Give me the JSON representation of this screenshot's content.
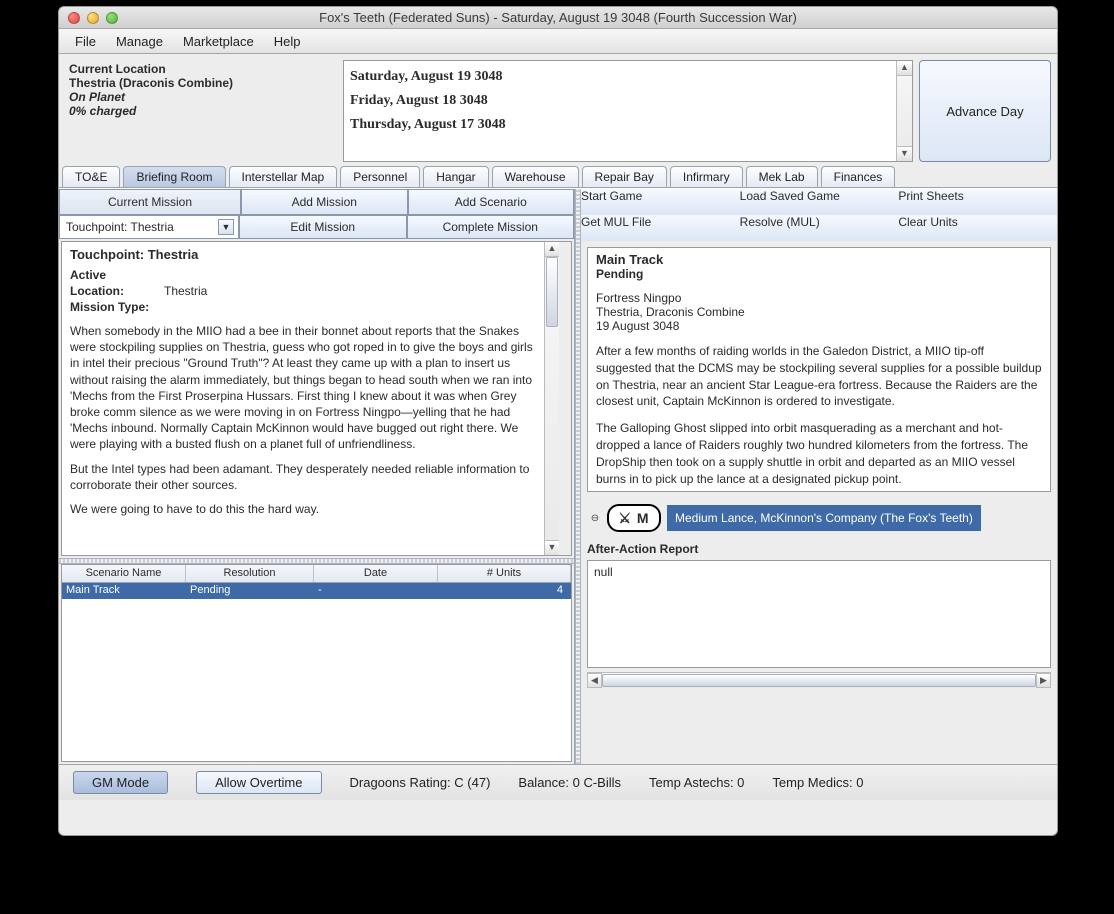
{
  "window": {
    "title": "Fox's Teeth (Federated Suns) - Saturday, August 19 3048 (Fourth Succession War)"
  },
  "menu": {
    "items": [
      "File",
      "Manage",
      "Marketplace",
      "Help"
    ]
  },
  "location": {
    "heading": "Current Location",
    "planet": "Thestria (Draconis Combine)",
    "status": "On Planet",
    "charge": "0% charged"
  },
  "log": {
    "entries": [
      "Saturday, August 19 3048",
      "Friday, August 18 3048",
      "Thursday, August 17 3048"
    ]
  },
  "advance_button": "Advance Day",
  "tabs": {
    "items": [
      "TO&E",
      "Briefing Room",
      "Interstellar Map",
      "Personnel",
      "Hangar",
      "Warehouse",
      "Repair Bay",
      "Infirmary",
      "Mek Lab",
      "Finances"
    ],
    "active_index": 1
  },
  "mission_panel": {
    "header": "Current Mission",
    "buttons": {
      "add_mission": "Add Mission",
      "add_scenario": "Add Scenario",
      "edit_mission": "Edit Mission",
      "complete_mission": "Complete Mission"
    },
    "selected": "Touchpoint: Thestria"
  },
  "briefing": {
    "title": "Touchpoint: Thestria",
    "status": "Active",
    "location_label": "Location:",
    "location_value": "Thestria",
    "mission_type_label": "Mission Type:",
    "para1": "When somebody in the MIIO had a bee in their bonnet about reports that the Snakes were stockpiling supplies on Thestria, guess who got roped in to give the boys and girls in intel their precious \"Ground Truth\"? At least they came up with a plan to insert us without raising the alarm immediately, but things began to head south when we ran into 'Mechs from the First Proserpina Hussars. First thing I knew about it was when Grey broke comm silence as we were moving in on Fortress Ningpo—yelling that he had 'Mechs inbound. Normally Captain McKinnon would have bugged out right there. We were playing with a busted flush on a planet full of unfriendliness.",
    "para2": "But the Intel types had been adamant. They desperately needed reliable information to corroborate their other sources.",
    "para3": "We were going to have to do this the hard way."
  },
  "scenario_table": {
    "headers": [
      "Scenario Name",
      "Resolution",
      "Date",
      "# Units"
    ],
    "rows": [
      {
        "name": "Main Track",
        "resolution": "Pending",
        "date": "-",
        "units": "4"
      }
    ]
  },
  "game_buttons": {
    "start": "Start Game",
    "load": "Load Saved Game",
    "print": "Print Sheets",
    "mul": "Get MUL File",
    "resolve": "Resolve (MUL)",
    "clear": "Clear Units"
  },
  "track": {
    "title": "Main Track",
    "status": "Pending",
    "loc1": "Fortress Ningpo",
    "loc2": "Thestria, Draconis Combine",
    "date": "19 August 3048",
    "para1": "After a few months of raiding worlds in the Galedon District, a MIIO tip-off suggested that the DCMS may be stockpiling several supplies for a possible buildup on Thestria, near an ancient Star League-era fortress. Because the Raiders are the closest unit, Captain McKinnon is ordered to investigate.",
    "para2": "The Galloping Ghost slipped into orbit masquerading as a merchant and hot-dropped a lance of Raiders roughly two hundred kilometers from the fortress. The DropShip then took on a supply shuttle in orbit and departed as an MIIO vessel burns in to pick up the lance at a designated pickup point."
  },
  "lance": {
    "icon_text": "⚔ M",
    "label": "Medium Lance, McKinnon's Company (The Fox's Teeth)"
  },
  "aar": {
    "heading": "After-Action Report",
    "text": "null"
  },
  "status": {
    "gm_mode": "GM Mode",
    "overtime": "Allow Overtime",
    "dragoons": "Dragoons Rating: C (47)",
    "balance": "Balance: 0 C-Bills",
    "astechs": "Temp Astechs: 0",
    "medics": "Temp Medics: 0"
  }
}
